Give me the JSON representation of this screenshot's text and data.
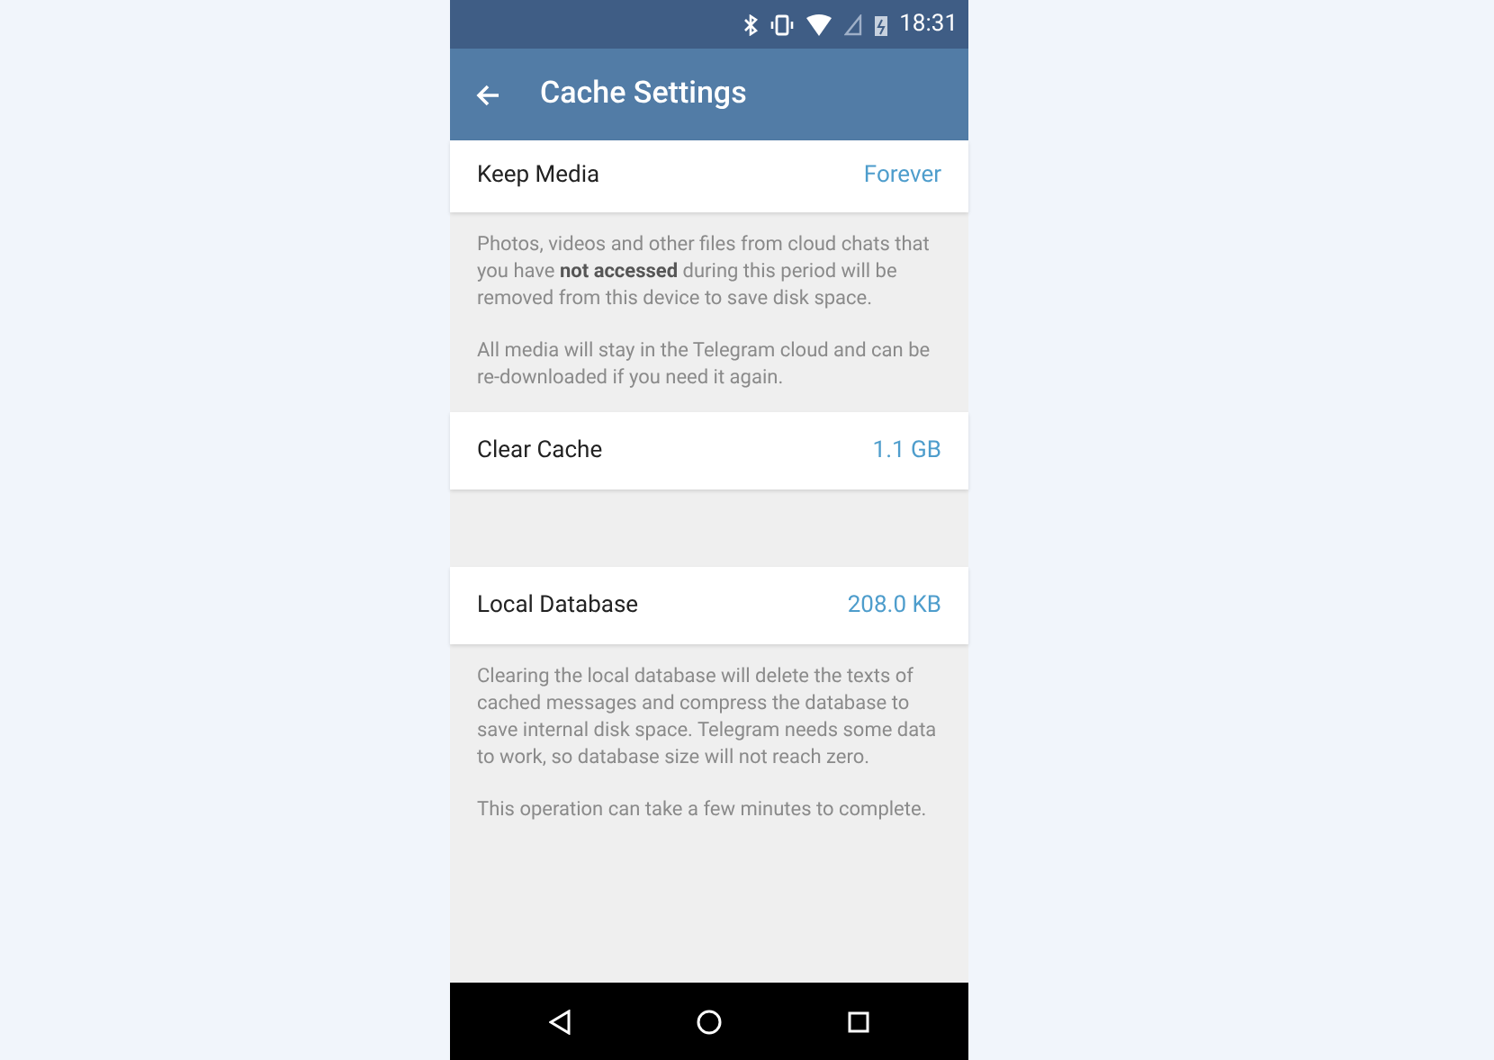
{
  "status_bar": {
    "time": "18:31"
  },
  "app_bar": {
    "title": "Cache Settings"
  },
  "sections": [
    {
      "row": {
        "label": "Keep Media",
        "value": "Forever"
      },
      "notes": [
        "Photos, videos and other files from cloud chats that you have **not accessed** during this period will be removed from this device to save disk space.",
        "All media will stay in the Telegram cloud and can be re-downloaded if you need it again."
      ]
    },
    {
      "row": {
        "label": "Clear Cache",
        "value": "1.1 GB"
      }
    },
    {
      "row": {
        "label": "Local Database",
        "value": "208.0 KB"
      },
      "notes": [
        "Clearing the local database will delete the texts of cached messages and compress the database to save internal disk space. Telegram needs some data to work, so database size will not reach zero.",
        "This operation can take a few minutes to complete."
      ]
    }
  ]
}
